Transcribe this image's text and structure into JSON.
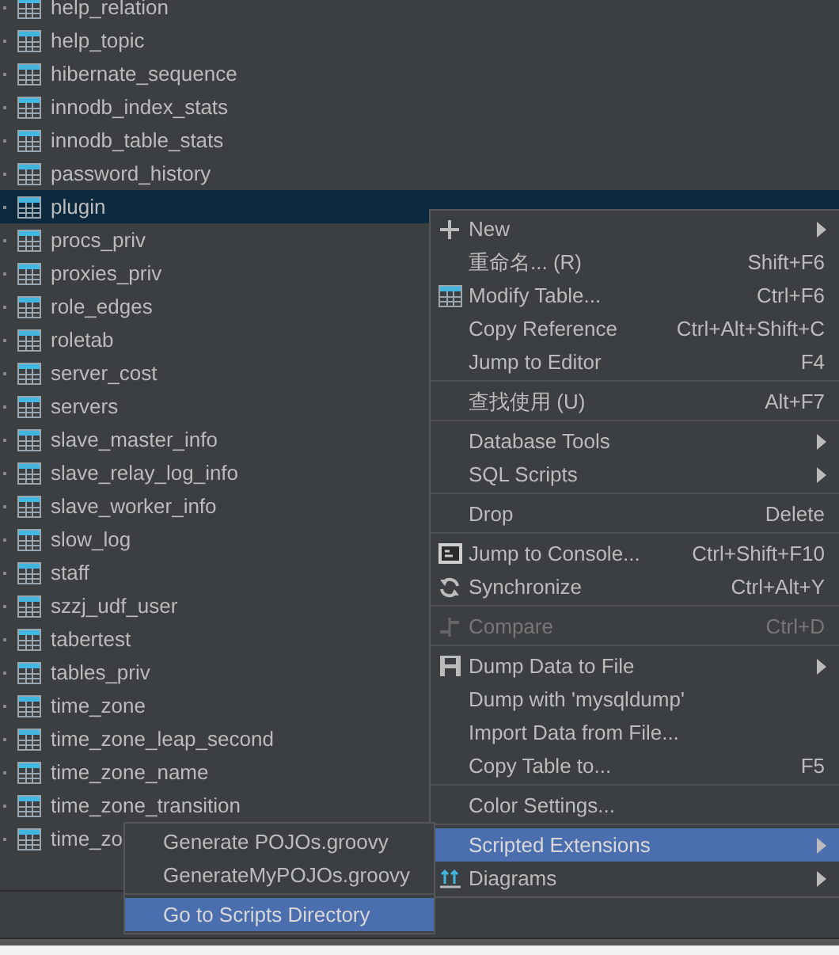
{
  "tree": {
    "items": [
      {
        "name": "help_relation",
        "selected": false
      },
      {
        "name": "help_topic",
        "selected": false
      },
      {
        "name": "hibernate_sequence",
        "selected": false
      },
      {
        "name": "innodb_index_stats",
        "selected": false
      },
      {
        "name": "innodb_table_stats",
        "selected": false
      },
      {
        "name": "password_history",
        "selected": false
      },
      {
        "name": "plugin",
        "selected": true
      },
      {
        "name": "procs_priv",
        "selected": false
      },
      {
        "name": "proxies_priv",
        "selected": false
      },
      {
        "name": "role_edges",
        "selected": false
      },
      {
        "name": "roletab",
        "selected": false
      },
      {
        "name": "server_cost",
        "selected": false
      },
      {
        "name": "servers",
        "selected": false
      },
      {
        "name": "slave_master_info",
        "selected": false
      },
      {
        "name": "slave_relay_log_info",
        "selected": false
      },
      {
        "name": "slave_worker_info",
        "selected": false
      },
      {
        "name": "slow_log",
        "selected": false
      },
      {
        "name": "staff",
        "selected": false
      },
      {
        "name": "szzj_udf_user",
        "selected": false
      },
      {
        "name": "tabertest",
        "selected": false
      },
      {
        "name": "tables_priv",
        "selected": false
      },
      {
        "name": "time_zone",
        "selected": false
      },
      {
        "name": "time_zone_leap_second",
        "selected": false
      },
      {
        "name": "time_zone_name",
        "selected": false
      },
      {
        "name": "time_zone_transition",
        "selected": false
      },
      {
        "name": "time_zo",
        "selected": false
      }
    ]
  },
  "context_menu": {
    "items": [
      {
        "kind": "add",
        "label": "New",
        "submenu": true,
        "disabled": false,
        "selected": false
      },
      {
        "kind": "plain",
        "label": "重命名... (R)",
        "shortcut": "Shift+F6",
        "submenu": false,
        "disabled": false,
        "selected": false
      },
      {
        "kind": "table",
        "label": "Modify Table...",
        "shortcut": "Ctrl+F6",
        "submenu": false,
        "disabled": false,
        "selected": false
      },
      {
        "kind": "plain",
        "label": "Copy Reference",
        "shortcut": "Ctrl+Alt+Shift+C",
        "submenu": false,
        "disabled": false,
        "selected": false
      },
      {
        "kind": "plain",
        "label": "Jump to Editor",
        "shortcut": "F4",
        "submenu": false,
        "disabled": false,
        "selected": false
      },
      {
        "kind": "separator"
      },
      {
        "kind": "plain",
        "label": "查找使用 (U)",
        "shortcut": "Alt+F7",
        "submenu": false,
        "disabled": false,
        "selected": false
      },
      {
        "kind": "separator"
      },
      {
        "kind": "plain",
        "label": "Database Tools",
        "submenu": true,
        "disabled": false,
        "selected": false
      },
      {
        "kind": "plain",
        "label": "SQL Scripts",
        "submenu": true,
        "disabled": false,
        "selected": false
      },
      {
        "kind": "separator"
      },
      {
        "kind": "plain",
        "label": "Drop",
        "shortcut": "Delete",
        "submenu": false,
        "disabled": false,
        "selected": false
      },
      {
        "kind": "separator"
      },
      {
        "kind": "console",
        "label": "Jump to Console...",
        "shortcut": "Ctrl+Shift+F10",
        "submenu": false,
        "disabled": false,
        "selected": false
      },
      {
        "kind": "sync",
        "label": "Synchronize",
        "shortcut": "Ctrl+Alt+Y",
        "submenu": false,
        "disabled": false,
        "selected": false
      },
      {
        "kind": "separator"
      },
      {
        "kind": "compare",
        "label": "Compare",
        "shortcut": "Ctrl+D",
        "submenu": false,
        "disabled": true,
        "selected": false
      },
      {
        "kind": "separator"
      },
      {
        "kind": "dump",
        "label": "Dump Data to File",
        "submenu": true,
        "disabled": false,
        "selected": false
      },
      {
        "kind": "plain",
        "label": "Dump with 'mysqldump'",
        "submenu": false,
        "disabled": false,
        "selected": false
      },
      {
        "kind": "plain",
        "label": "Import Data from File...",
        "submenu": false,
        "disabled": false,
        "selected": false
      },
      {
        "kind": "plain",
        "label": "Copy Table to...",
        "shortcut": "F5",
        "submenu": false,
        "disabled": false,
        "selected": false
      },
      {
        "kind": "separator"
      },
      {
        "kind": "plain",
        "label": "Color Settings...",
        "submenu": false,
        "disabled": false,
        "selected": false
      },
      {
        "kind": "separator"
      },
      {
        "kind": "plain",
        "label": "Scripted Extensions",
        "submenu": true,
        "disabled": false,
        "selected": true
      },
      {
        "kind": "diagram",
        "label": "Diagrams",
        "submenu": true,
        "disabled": false,
        "selected": false
      }
    ]
  },
  "submenu": {
    "items": [
      {
        "kind": "plain",
        "label": "Generate POJOs.groovy",
        "selected": false
      },
      {
        "kind": "plain",
        "label": "GenerateMyPOJOs.groovy",
        "selected": false
      },
      {
        "kind": "separator"
      },
      {
        "kind": "plain",
        "label": "Go to Scripts Directory",
        "selected": true
      }
    ]
  }
}
